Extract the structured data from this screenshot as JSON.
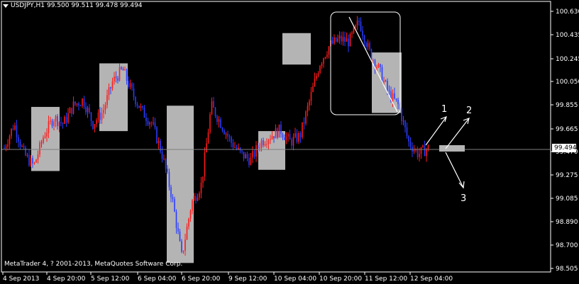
{
  "header": {
    "symbol": "USDJPY,H1",
    "ohlc": "99.500 99.511 99.478 99.494"
  },
  "copyright": "MetaTrader 4, ? 2001-2013, MetaQuotes Software Corp.",
  "price_axis": {
    "ticks": [
      "100.630",
      "100.435",
      "100.245",
      "100.050",
      "99.855",
      "99.665",
      "99.470",
      "99.275",
      "99.085",
      "98.890",
      "98.700",
      "98.505"
    ],
    "current_price": "99.494"
  },
  "time_axis": {
    "labels": [
      "4 Sep 2013",
      "4 Sep 20:00",
      "5 Sep 12:00",
      "6 Sep 04:00",
      "6 Sep 20:00",
      "9 Sep 12:00",
      "10 Sep 04:00",
      "10 Sep 20:00",
      "11 Sep 12:00",
      "12 Sep 04:00"
    ]
  },
  "annotations": {
    "label_1": "1",
    "label_2": "2",
    "label_3": "3"
  },
  "colors": {
    "background": "#000000",
    "bull_candle": "#ff1a1a",
    "bear_candle": "#2a3cff",
    "highlight_box": "#b4b4b4",
    "axis": "#ffffff",
    "price_line": "#7f7f7f"
  },
  "chart_data": {
    "type": "candlestick",
    "symbol": "USDJPY",
    "timeframe": "H1",
    "ylim": [
      98.505,
      100.63
    ],
    "highlight_zones": [
      {
        "from": "4 Sep 2013",
        "low": 99.31,
        "high": 99.84
      },
      {
        "from": "5 Sep 12:00",
        "low": 99.64,
        "high": 100.2
      },
      {
        "from": "6 Sep 04:00",
        "low": 98.55,
        "high": 99.85
      },
      {
        "from": "9 Sep 12:00",
        "low": 99.32,
        "high": 99.64
      },
      {
        "from": "10 Sep 04:00",
        "low": 100.19,
        "high": 100.45
      },
      {
        "from": "11 Sep 12:00",
        "low": 99.79,
        "high": 100.29
      }
    ],
    "price_path": [
      99.5,
      99.7,
      99.45,
      99.35,
      99.6,
      99.75,
      99.7,
      99.85,
      99.9,
      99.7,
      99.8,
      100.05,
      100.15,
      99.95,
      99.8,
      99.7,
      99.45,
      99.1,
      98.6,
      99.05,
      99.2,
      99.85,
      99.7,
      99.55,
      99.45,
      99.4,
      99.55,
      99.6,
      99.65,
      99.55,
      99.6,
      99.9,
      100.2,
      100.35,
      100.4,
      100.38,
      100.55,
      100.3,
      100.15,
      99.95,
      99.85,
      99.55,
      99.45,
      99.5
    ]
  }
}
